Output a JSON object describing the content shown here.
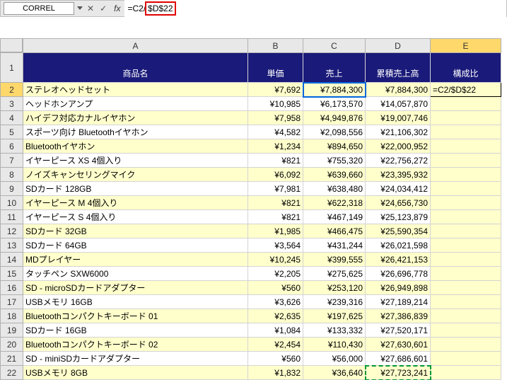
{
  "formula_bar": {
    "name_box": "CORREL",
    "fx": "fx",
    "formula_prefix": "=C2/",
    "formula_highlighted": "$D$22"
  },
  "columns": {
    "a": "A",
    "b": "B",
    "c": "C",
    "d": "D",
    "e": "E"
  },
  "headers": {
    "name": "商品名",
    "price": "単価",
    "sales": "売上",
    "cum_sales": "累積売上高",
    "ratio": "構成比"
  },
  "active_formula": "=C2/$D$22",
  "rows": [
    {
      "n": "2",
      "name": "ステレオヘッドセット",
      "price": "¥7,692",
      "sales": "¥7,884,300",
      "cum": "¥7,884,300"
    },
    {
      "n": "3",
      "name": "ヘッドホンアンプ",
      "price": "¥10,985",
      "sales": "¥6,173,570",
      "cum": "¥14,057,870"
    },
    {
      "n": "4",
      "name": "ハイデフ対応カナルイヤホン",
      "price": "¥7,958",
      "sales": "¥4,949,876",
      "cum": "¥19,007,746"
    },
    {
      "n": "5",
      "name": "スポーツ向け Bluetoothイヤホン",
      "price": "¥4,582",
      "sales": "¥2,098,556",
      "cum": "¥21,106,302"
    },
    {
      "n": "6",
      "name": "Bluetoothイヤホン",
      "price": "¥1,234",
      "sales": "¥894,650",
      "cum": "¥22,000,952"
    },
    {
      "n": "7",
      "name": "イヤーピース XS 4個入り",
      "price": "¥821",
      "sales": "¥755,320",
      "cum": "¥22,756,272"
    },
    {
      "n": "8",
      "name": "ノイズキャンセリングマイク",
      "price": "¥6,092",
      "sales": "¥639,660",
      "cum": "¥23,395,932"
    },
    {
      "n": "9",
      "name": "SDカード 128GB",
      "price": "¥7,981",
      "sales": "¥638,480",
      "cum": "¥24,034,412"
    },
    {
      "n": "10",
      "name": "イヤーピース M 4個入り",
      "price": "¥821",
      "sales": "¥622,318",
      "cum": "¥24,656,730"
    },
    {
      "n": "11",
      "name": "イヤーピース S 4個入り",
      "price": "¥821",
      "sales": "¥467,149",
      "cum": "¥25,123,879"
    },
    {
      "n": "12",
      "name": "SDカード 32GB",
      "price": "¥1,985",
      "sales": "¥466,475",
      "cum": "¥25,590,354"
    },
    {
      "n": "13",
      "name": "SDカード 64GB",
      "price": "¥3,564",
      "sales": "¥431,244",
      "cum": "¥26,021,598"
    },
    {
      "n": "14",
      "name": "MDプレイヤー",
      "price": "¥10,245",
      "sales": "¥399,555",
      "cum": "¥26,421,153"
    },
    {
      "n": "15",
      "name": "タッチペン SXW6000",
      "price": "¥2,205",
      "sales": "¥275,625",
      "cum": "¥26,696,778"
    },
    {
      "n": "16",
      "name": "SD - microSDカードアダプター",
      "price": "¥560",
      "sales": "¥253,120",
      "cum": "¥26,949,898"
    },
    {
      "n": "17",
      "name": "USBメモリ 16GB",
      "price": "¥3,626",
      "sales": "¥239,316",
      "cum": "¥27,189,214"
    },
    {
      "n": "18",
      "name": "Bluetoothコンパクトキーボード 01",
      "price": "¥2,635",
      "sales": "¥197,625",
      "cum": "¥27,386,839"
    },
    {
      "n": "19",
      "name": "SDカード 16GB",
      "price": "¥1,084",
      "sales": "¥133,332",
      "cum": "¥27,520,171"
    },
    {
      "n": "20",
      "name": "Bluetoothコンパクトキーボード 02",
      "price": "¥2,454",
      "sales": "¥110,430",
      "cum": "¥27,630,601"
    },
    {
      "n": "21",
      "name": "SD - miniSDカードアダプター",
      "price": "¥560",
      "sales": "¥56,000",
      "cum": "¥27,686,601"
    },
    {
      "n": "22",
      "name": "USBメモリ 8GB",
      "price": "¥1,832",
      "sales": "¥36,640",
      "cum": "¥27,723,241"
    }
  ]
}
